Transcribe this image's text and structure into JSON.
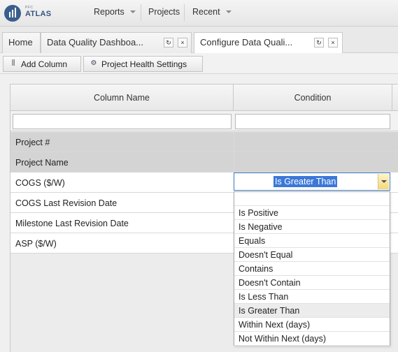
{
  "nav": {
    "logo_pre": "PFC",
    "logo_name": "ATLAS",
    "reports": "Reports",
    "projects": "Projects",
    "recent": "Recent"
  },
  "tabs": [
    {
      "label": "Home"
    },
    {
      "label": "Data Quality Dashboa..."
    },
    {
      "label": "Configure Data Quali..."
    }
  ],
  "tab_buttons": {
    "refresh": "↻",
    "close": "×"
  },
  "toolbar": {
    "add_column": "Add Column",
    "project_health": "Project Health Settings"
  },
  "grid": {
    "headers": [
      "Column Name",
      "Condition"
    ],
    "rows": [
      {
        "name": "Project #",
        "style": "grey"
      },
      {
        "name": "Project Name",
        "style": "grey"
      },
      {
        "name": "COGS ($/W)",
        "style": "white"
      },
      {
        "name": "COGS Last Revision Date",
        "style": "white"
      },
      {
        "name": "Milestone Last Revision Date",
        "style": "white"
      },
      {
        "name": "ASP ($/W)",
        "style": "white"
      }
    ]
  },
  "condition": {
    "selected": "Is Greater Than",
    "options": [
      "",
      "Is Positive",
      "Is Negative",
      "Equals",
      "Doesn't Equal",
      "Contains",
      "Doesn't Contain",
      "Is Less Than",
      "Is Greater Than",
      "Within Next (days)",
      "Not Within Next (days)"
    ]
  },
  "colors": {
    "accent": "#3b78d8",
    "row_grey": "#d4d4d4"
  }
}
